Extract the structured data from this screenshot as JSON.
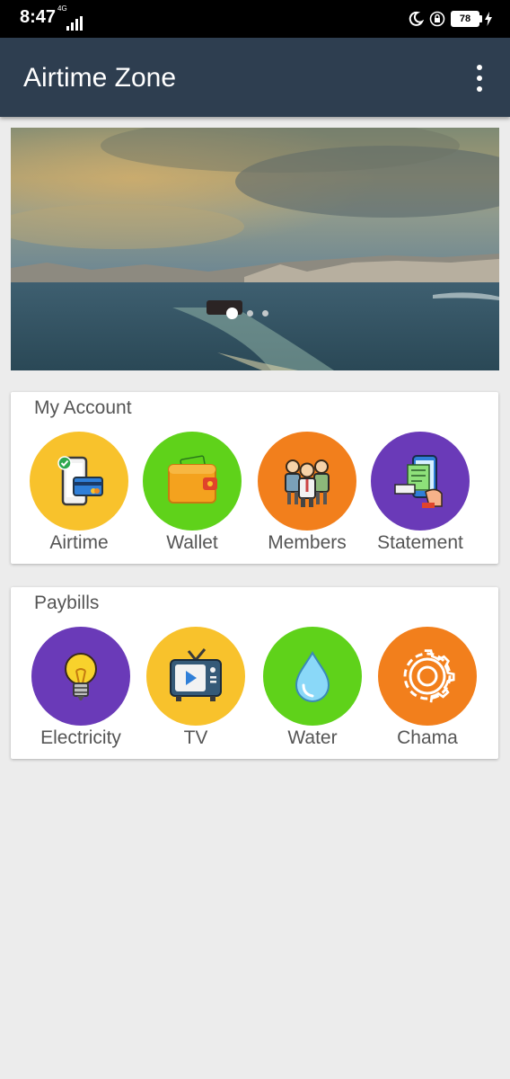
{
  "status_bar": {
    "time": "8:47",
    "network": "4G",
    "battery": "78"
  },
  "app_bar": {
    "title": "Airtime Zone"
  },
  "banner": {
    "slides": 3,
    "active_slide": 1
  },
  "my_account": {
    "title": "My Account",
    "items": [
      {
        "label": "Airtime",
        "icon": "phone-card-icon",
        "color": "#f8c22c"
      },
      {
        "label": "Wallet",
        "icon": "wallet-icon",
        "color": "#5fd21a"
      },
      {
        "label": "Members",
        "icon": "members-icon",
        "color": "#f27f1c"
      },
      {
        "label": "Statement",
        "icon": "statement-icon",
        "color": "#6a3ab8"
      }
    ]
  },
  "paybills": {
    "title": "Paybills",
    "items": [
      {
        "label": "Electricity",
        "icon": "lightbulb-icon",
        "color": "#6a3ab8"
      },
      {
        "label": "TV",
        "icon": "tv-icon",
        "color": "#f8c22c"
      },
      {
        "label": "Water",
        "icon": "water-drop-icon",
        "color": "#5fd21a"
      },
      {
        "label": "Chama",
        "icon": "gear-icon",
        "color": "#f27f1c"
      }
    ]
  }
}
